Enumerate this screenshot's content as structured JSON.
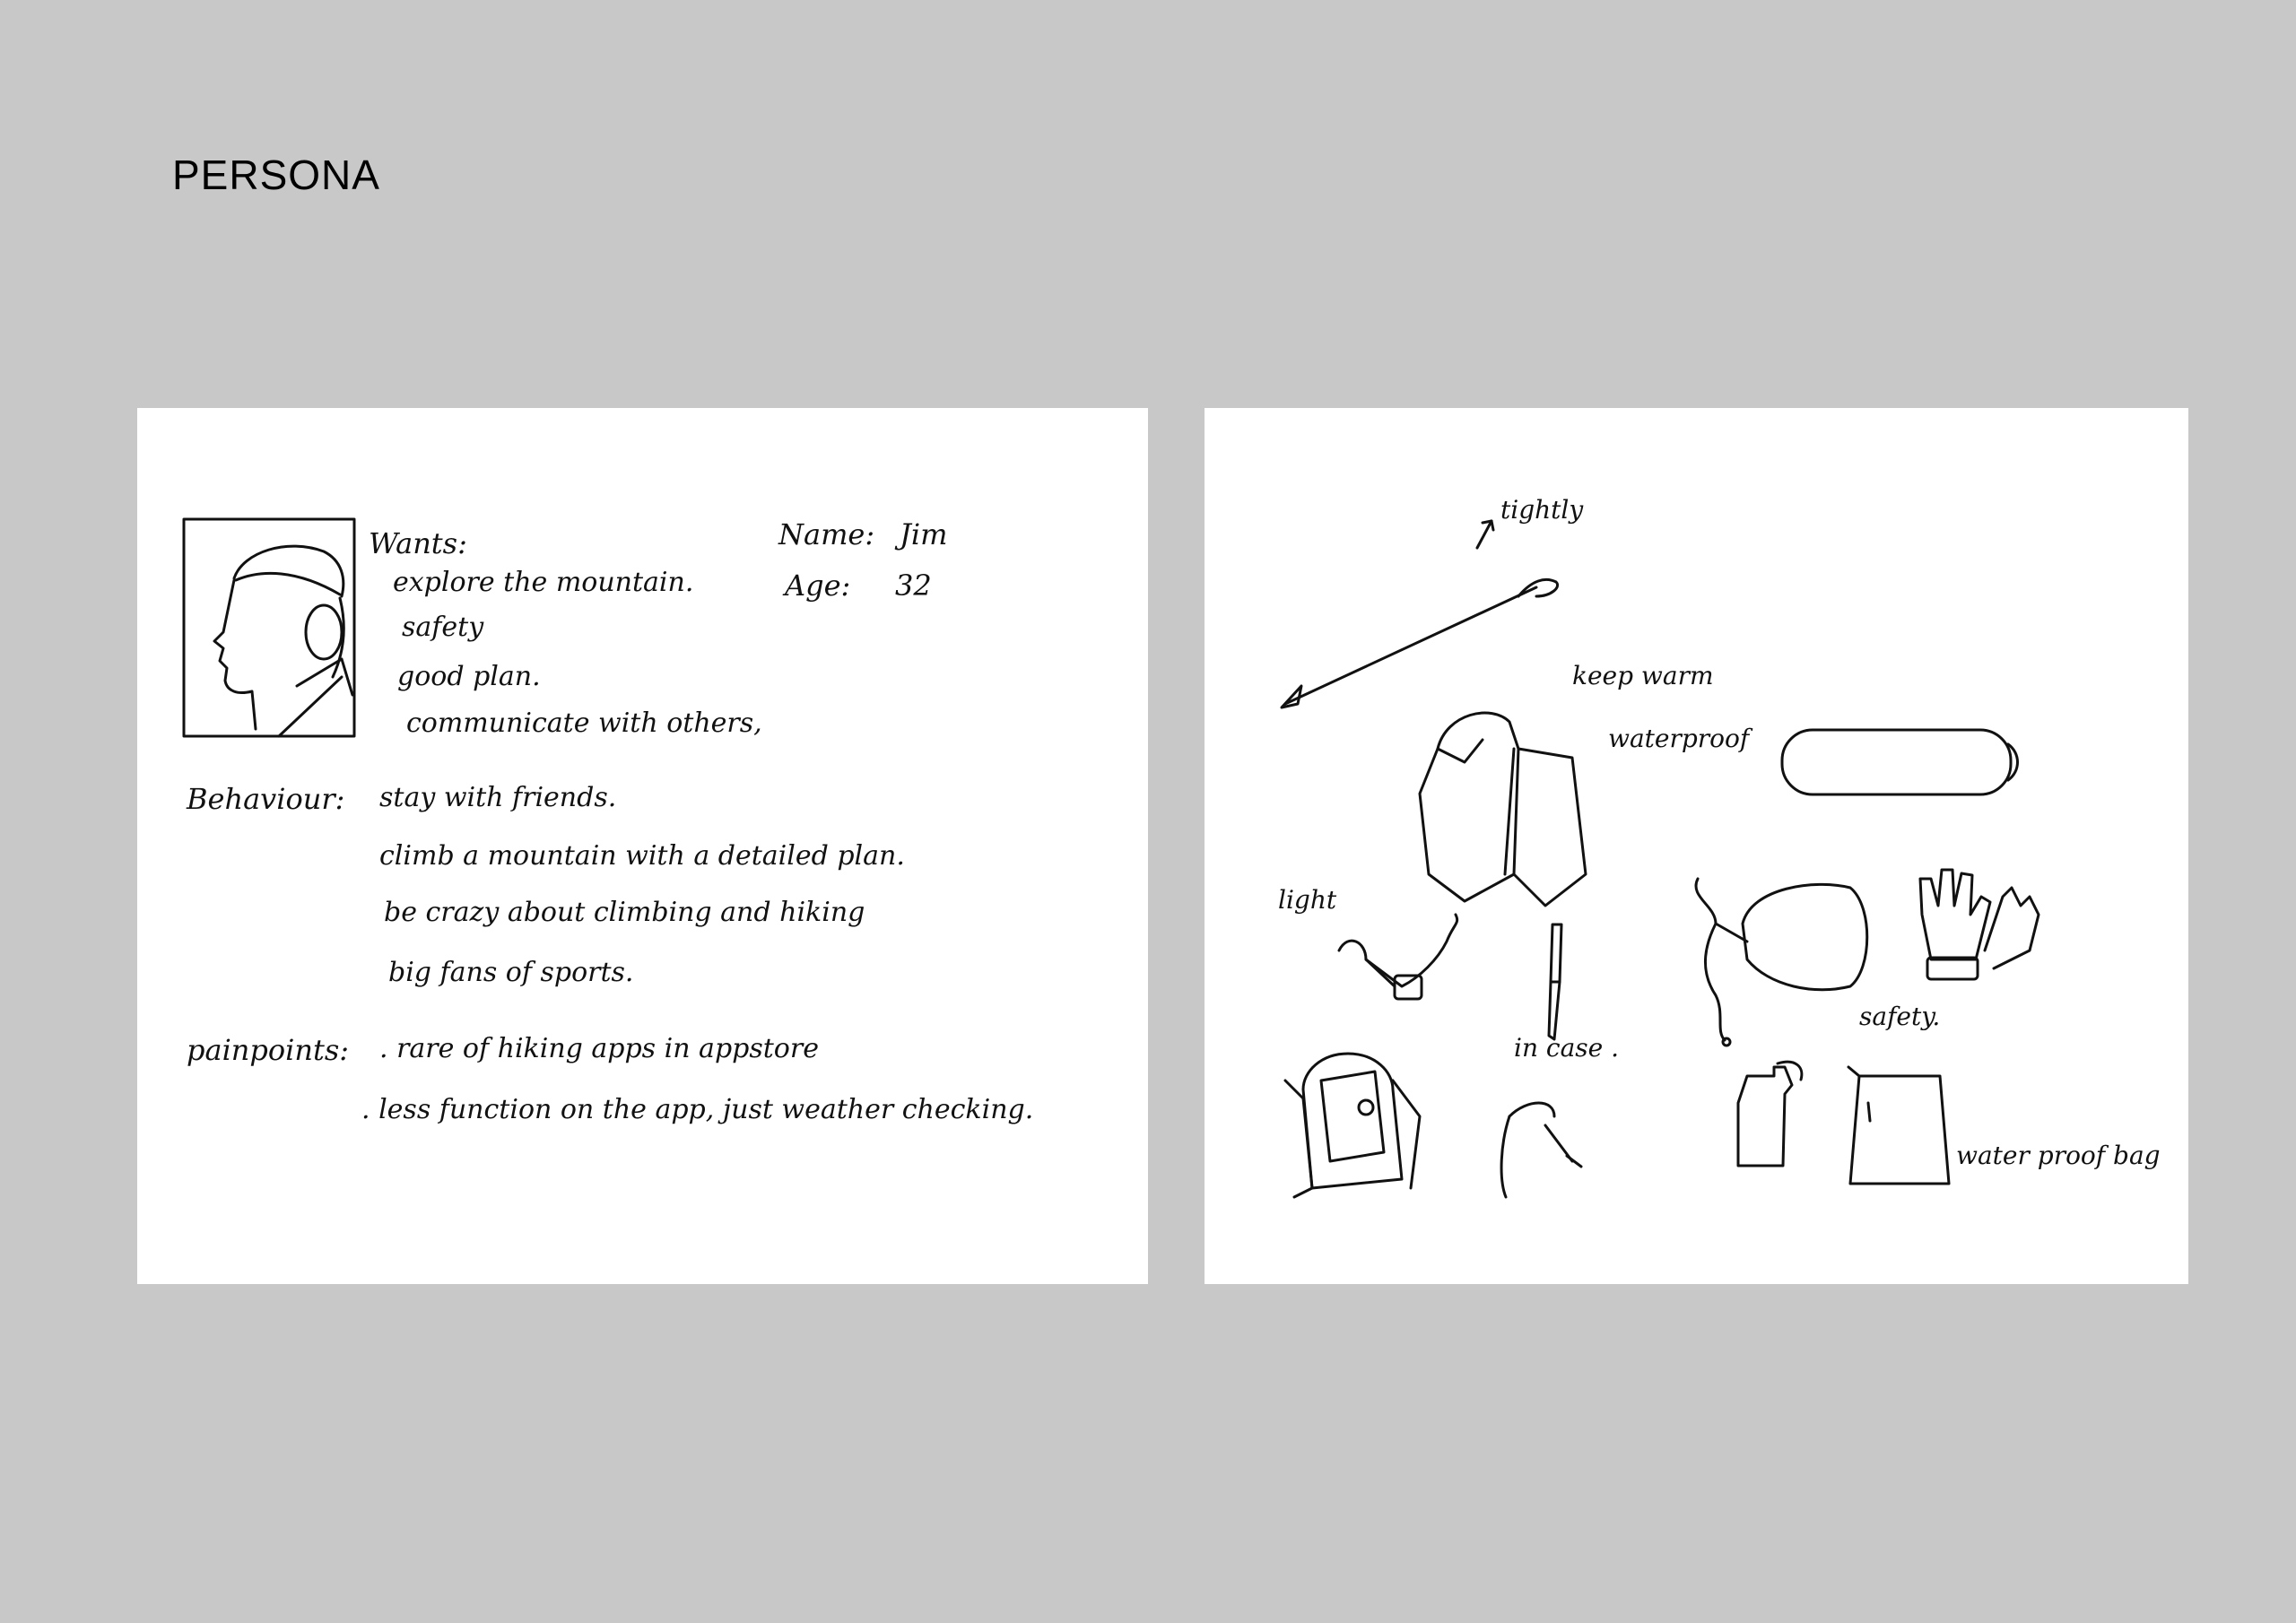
{
  "page": {
    "title": "PERSONA"
  },
  "persona_card": {
    "wants_label": "Wants:",
    "wants": [
      "explore the mountain.",
      "safety",
      "good plan.",
      "communicate with others,"
    ],
    "name_label": "Name:",
    "name_value": "Jim",
    "age_label": "Age:",
    "age_value": "32",
    "behaviour_label": "Behaviour:",
    "behaviours": [
      "stay with friends.",
      "climb a mountain with a detailed plan.",
      "be crazy about climbing and hiking",
      "big fans of sports."
    ],
    "painpoints_label": "painpoints:",
    "painpoints": [
      ". rare of hiking apps in appstore",
      ". less function on the app, just weather checking."
    ]
  },
  "gear_card": {
    "labels": {
      "tightly": "tightly",
      "keep_warm": "keep warm",
      "waterproof": "waterproof",
      "light": "light",
      "in_case": "in case .",
      "safety": "safety.",
      "water_proof_bag": "water proof bag"
    }
  }
}
